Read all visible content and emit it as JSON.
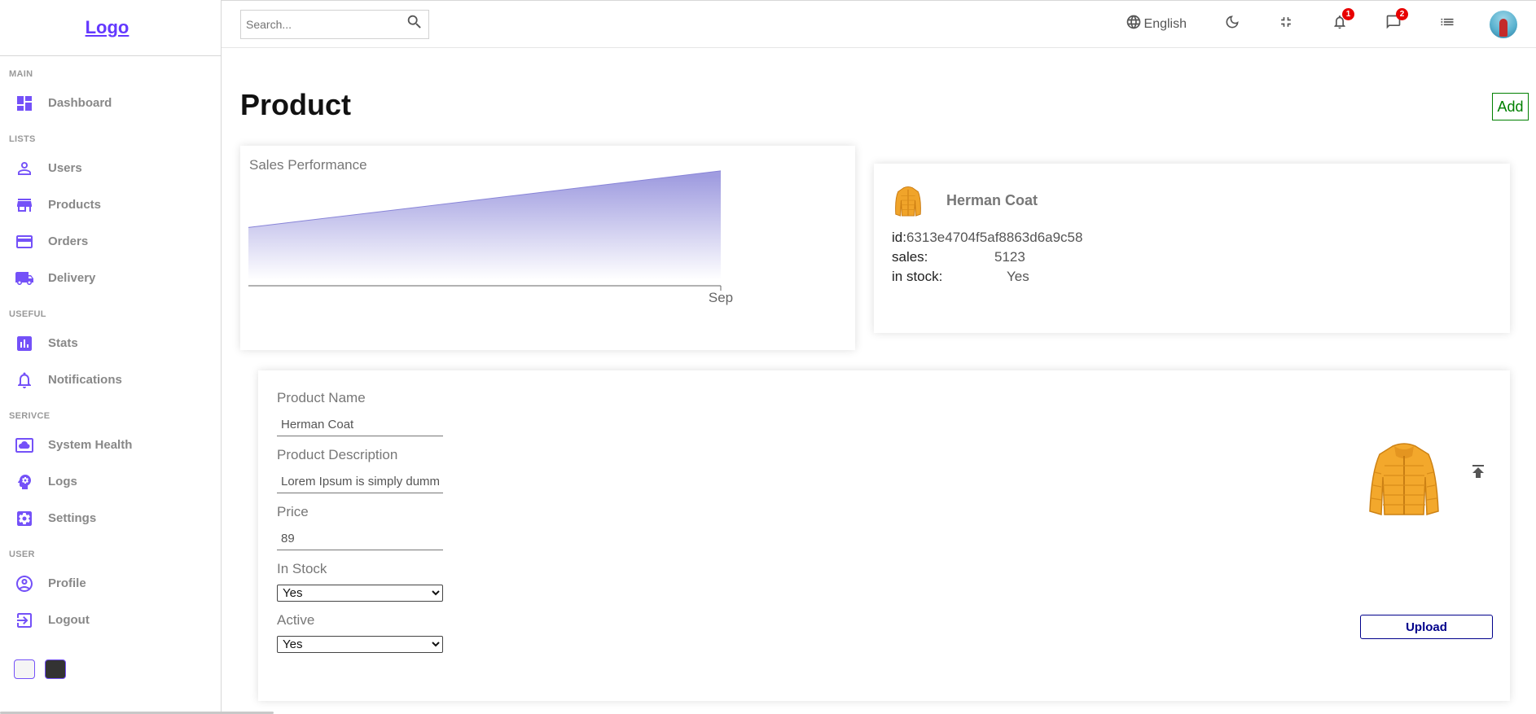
{
  "sidebar": {
    "logo": "Logo",
    "sections": [
      {
        "title": "MAIN",
        "items": [
          {
            "label": "Dashboard",
            "icon": "dashboard-icon"
          }
        ]
      },
      {
        "title": "LISTS",
        "items": [
          {
            "label": "Users",
            "icon": "person-icon"
          },
          {
            "label": "Products",
            "icon": "store-icon"
          },
          {
            "label": "Orders",
            "icon": "credit-card-icon"
          },
          {
            "label": "Delivery",
            "icon": "truck-icon"
          }
        ]
      },
      {
        "title": "USEFUL",
        "items": [
          {
            "label": "Stats",
            "icon": "bar-chart-icon"
          },
          {
            "label": "Notifications",
            "icon": "bell-icon"
          }
        ]
      },
      {
        "title": "SERIVCE",
        "items": [
          {
            "label": "System Health",
            "icon": "cloud-icon"
          },
          {
            "label": "Logs",
            "icon": "psychology-icon"
          },
          {
            "label": "Settings",
            "icon": "settings-icon"
          }
        ]
      },
      {
        "title": "USER",
        "items": [
          {
            "label": "Profile",
            "icon": "account-circle-icon"
          },
          {
            "label": "Logout",
            "icon": "logout-icon"
          }
        ]
      }
    ]
  },
  "navbar": {
    "search_placeholder": "Search...",
    "language": "English",
    "notifications_count": "1",
    "messages_count": "2"
  },
  "page": {
    "title": "Product",
    "add_label": "Add"
  },
  "chart_data": {
    "type": "area",
    "title": "Sales Performance",
    "x": [
      "",
      "Sep"
    ],
    "values": [
      50,
      100
    ],
    "xlabel": "",
    "ylabel": "",
    "color": "#8884d8",
    "grid": false
  },
  "info": {
    "name": "Herman Coat",
    "id_label": "id:",
    "id_value": "6313e4704f5af8863d6a9c58",
    "sales_label": "sales:",
    "sales_value": "5123",
    "stock_label": "in stock:",
    "stock_value": "Yes"
  },
  "form": {
    "name_label": "Product Name",
    "name_value": "Herman Coat",
    "desc_label": "Product Description",
    "desc_value": "Lorem Ipsum is simply dummy text of the printing and typesetting industry.",
    "price_label": "Price",
    "price_value": "89",
    "stock_label": "In Stock",
    "stock_value": "Yes",
    "active_label": "Active",
    "active_value": "Yes",
    "upload_label": "Upload"
  },
  "colors": {
    "accent": "#7451f8",
    "logo": "#6439ff",
    "add": "green",
    "upload": "darkblue",
    "badge": "#e80000"
  }
}
